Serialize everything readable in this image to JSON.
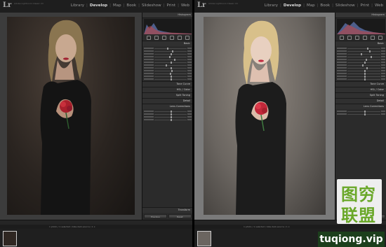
{
  "app": {
    "logo": "Lr"
  },
  "left": {
    "catalog": "Adobe Lightroom Classic CC",
    "modules": [
      "Library",
      "Develop",
      "Map",
      "Book",
      "Slideshow",
      "Print",
      "Web"
    ],
    "active_module": "Develop",
    "panel_title": "Histogram",
    "sections": [
      "Basic",
      "Tone Curve",
      "HSL / Color",
      "Split Toning",
      "Detail",
      "Lens Corrections",
      "Transform"
    ],
    "buttons": [
      "Previous",
      "Reset"
    ],
    "filmstrip_info": "1 photo / 1 selected / bike-dark-source / 1 x"
  },
  "right": {
    "catalog": "Adobe Lightroom Classic CC",
    "modules": [
      "Library",
      "Develop",
      "Map",
      "Book",
      "Slideshow",
      "Print",
      "Web"
    ],
    "active_module": "Develop",
    "panel_title": "Histogram",
    "sections": [
      "Basic",
      "Tone Curve",
      "HSL / Color",
      "Split Toning",
      "Detail",
      "Lens Corrections",
      "Transform"
    ],
    "buttons": [
      "Previous",
      "Reset (Adobe)"
    ],
    "filmstrip_info": "1 photo / 1 selected / bike-dark-source / 1 x"
  },
  "watermark": {
    "chinese": [
      "图穷",
      "联盟"
    ],
    "url": "tuqiong.vip",
    "color": "#6aa829"
  }
}
